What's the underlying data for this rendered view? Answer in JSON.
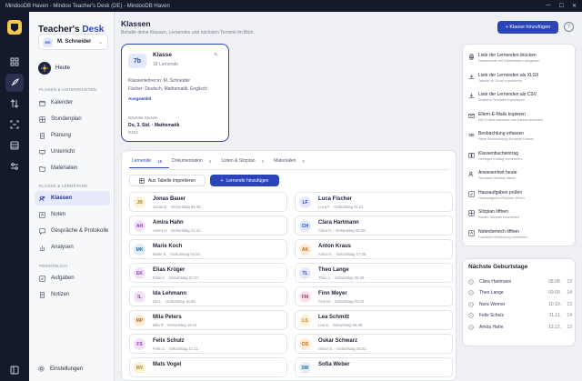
{
  "window": {
    "title": "MindooDB Haven - Mindoo Teacher's Desk (DE) - MindooDB Haven"
  },
  "brand": {
    "part1": "Teacher's ",
    "part2": "Desk"
  },
  "user": {
    "initials": "MS",
    "name": "M. Schneider"
  },
  "sidebar": {
    "home": "Heute",
    "section1": "PLANEN & UNTERRICHTEN",
    "items1": [
      "Kalender",
      "Stundenplan",
      "Planung",
      "Unterricht",
      "Materialien"
    ],
    "section2": "KLASSE & LERNSTAND",
    "items2": [
      "Klassen",
      "Noten",
      "Gespräche & Protokolle",
      "Analysen"
    ],
    "section3": "PERSÖNLICH",
    "items3": [
      "Aufgaben",
      "Notizen"
    ],
    "settings": "Einstellungen"
  },
  "header": {
    "title": "Klassen",
    "subtitle": "Behalte deine Klassen, Lernenden und nächsten Termine im Blick.",
    "add_class": "Klasse hinzufügen",
    "help": "?"
  },
  "class_card": {
    "badge": "7b",
    "title": "Klasse",
    "count": "18 Lernende",
    "teacher": "Klassenlehrer:in: M. Schneider",
    "subjects": "Fächer: Deutsch, Mathematik, Englisch",
    "selected": "Ausgewählt",
    "next_label": "Nächste Stunde",
    "next_when": "Do, 3. Std. · Mathematik",
    "room": "R203"
  },
  "tabs": [
    {
      "label": "Lernende",
      "count": "18"
    },
    {
      "label": "Dokumentation",
      "count": "3"
    },
    {
      "label": "Listen & Sitzplan",
      "count": "3"
    },
    {
      "label": "Materialien",
      "count": "0"
    }
  ],
  "toolbar": {
    "import": "Aus Tabelle importieren",
    "add_student": "Lernende hinzufügen"
  },
  "students": [
    {
      "initials": "JB",
      "name": "Jonas Bauer",
      "meta": "Jonas B. · Geburtstag 05.05.",
      "bg": "#fbf1d6",
      "fg": "#b7832a"
    },
    {
      "initials": "LF",
      "name": "Luca Fischer",
      "meta": "Luca F. · Geburtstag 01.01.",
      "bg": "#e3e8fb",
      "fg": "#2b45b8"
    },
    {
      "initials": "AH",
      "name": "Amira Hahn",
      "meta": "Amira H. · Geburtstag 12.12.",
      "bg": "#f0e3f7",
      "fg": "#8c3ab3"
    },
    {
      "initials": "CH",
      "name": "Clara Hartmann",
      "meta": "Clara H. · Geburtstag 08.08.",
      "bg": "#e3e8fb",
      "fg": "#2b45b8"
    },
    {
      "initials": "MK",
      "name": "Marie Koch",
      "meta": "Marie K. · Geburtstag 04.04.",
      "bg": "#e2eef6",
      "fg": "#2d6e95"
    },
    {
      "initials": "AK",
      "name": "Anton Kraus",
      "meta": "Anton K. · Geburtstag 17.05.",
      "bg": "#fbebd6",
      "fg": "#b86a22"
    },
    {
      "initials": "EK",
      "name": "Elias Krüger",
      "meta": "Elias K. · Geburtstag 07.07.",
      "bg": "#f0e3f7",
      "fg": "#8c3ab3"
    },
    {
      "initials": "TL",
      "name": "Theo Lange",
      "meta": "Theo L. · Geburtstag 09.09.",
      "bg": "#e3e8fb",
      "fg": "#2b45b8"
    },
    {
      "initials": "IL",
      "name": "Ida Lehmann",
      "meta": "Ida L. · Geburtstag 18.05.",
      "bg": "#f0e3f7",
      "fg": "#8c3ab3"
    },
    {
      "initials": "FM",
      "name": "Finn Meyer",
      "meta": "Finn M. · Geburtstag 03.03.",
      "bg": "#f7e3ef",
      "fg": "#a8386d"
    },
    {
      "initials": "MP",
      "name": "Mila Peters",
      "meta": "Mila P. · Geburtstag 16.04.",
      "bg": "#fbebd6",
      "fg": "#b86a22"
    },
    {
      "initials": "LS",
      "name": "Lea Schmitt",
      "meta": "Lea S. · Geburtstag 06.06.",
      "bg": "#fbf1d6",
      "fg": "#b7832a"
    },
    {
      "initials": "FS",
      "name": "Felix Schulz",
      "meta": "Felix S. · Geburtstag 11.11.",
      "bg": "#f0e3f7",
      "fg": "#8c3ab3"
    },
    {
      "initials": "OS",
      "name": "Oskar Schwarz",
      "meta": "Oskar S. · Geburtstag 15.03.",
      "bg": "#fbebd6",
      "fg": "#b86a22"
    },
    {
      "initials": "MV",
      "name": "Mats Vogel",
      "meta": "",
      "bg": "#fbf1d6",
      "fg": "#b7832a"
    },
    {
      "initials": "SW",
      "name": "Sofia Weber",
      "meta": "",
      "bg": "#e2eef6",
      "fg": "#2d6e95"
    }
  ],
  "actions": [
    {
      "title": "Liste der Lernenden drucken",
      "sub": "Namensliste mit Stammdaten ausgeben",
      "icon": "print-icon"
    },
    {
      "title": "Liste der Lernenden als XLSX",
      "sub": "Tabelle für Excel exportieren",
      "icon": "download-icon"
    },
    {
      "title": "Liste der Lernenden als CSV",
      "sub": "Einfache Textdatei exportieren",
      "icon": "download-icon"
    },
    {
      "title": "Eltern-E-Mails kopieren",
      "sub": "Alle E-Mail-Adressen der Klasse sammeln",
      "icon": "mail-icon"
    },
    {
      "title": "Beobachtung erfassen",
      "sub": "Neue Beobachtung für diese Klasse",
      "icon": "eye-icon"
    },
    {
      "title": "Klassenbucheintrag",
      "sub": "Heutigen Eintrag vorbereiten",
      "icon": "book-icon"
    },
    {
      "title": "Anwesenheit heute",
      "sub": "Standard-Sitzliste öffnen",
      "icon": "users-icon"
    },
    {
      "title": "Hausaufgaben prüfen",
      "sub": "Hausaufgaben-Sitzliste öffnen",
      "icon": "check-icon"
    },
    {
      "title": "Sitzplan öffnen",
      "sub": "Raster-Sitzplan bearbeiten",
      "icon": "grid-icon"
    },
    {
      "title": "Notenbereich öffnen",
      "sub": "Fachliche Bewertung bearbeiten",
      "icon": "grade-icon"
    }
  ],
  "birthdays": {
    "title": "Nächste Geburtstage",
    "items": [
      {
        "name": "Clara Hartmann",
        "date": "08.08.",
        "days": "13"
      },
      {
        "name": "Theo Lange",
        "date": "09.09.",
        "days": "14"
      },
      {
        "name": "Nora Werner",
        "date": "10.10.",
        "days": "13"
      },
      {
        "name": "Felix Schulz",
        "date": "11.11.",
        "days": "14"
      },
      {
        "name": "Amira Hahn",
        "date": "12.12.",
        "days": "13"
      }
    ]
  }
}
